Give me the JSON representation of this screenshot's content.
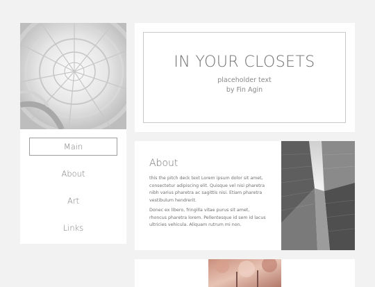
{
  "sidebar": {
    "items": [
      {
        "label": "Main",
        "active": true
      },
      {
        "label": "About",
        "active": false
      },
      {
        "label": "Art",
        "active": false
      },
      {
        "label": "Links",
        "active": false
      }
    ]
  },
  "header": {
    "title": "IN YOUR CLOSETS",
    "subtitle": "placeholder text",
    "author": "by Fin Agin"
  },
  "about": {
    "title": "About",
    "paragraphs": [
      "this the pitch deck text Lorem ipsum dolor sit amet, consectetur adipiscing elit. Quisque vel nisi pharetra nibh varius pharetra ac sagittis nisi. Etiam pharetra vestibulum hendrerit.",
      "Donec ex libero, fringilla vitae purus sit amet, rhoncus pharetra lorem. Pellentesque id sem id lacus ultricies vehicula. Aliquam rutrum mi non."
    ]
  },
  "colors": {
    "page_background": "#f2f2f2",
    "card_background": "#ffffff",
    "text": "#707070",
    "border": "#9d9d9d"
  }
}
